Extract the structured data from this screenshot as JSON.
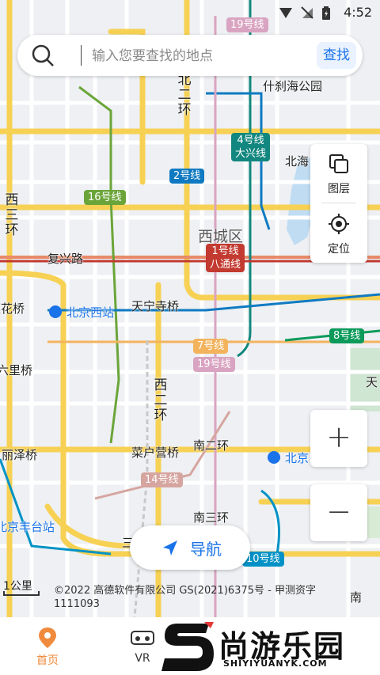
{
  "status_bar": {
    "time": "4:52"
  },
  "search": {
    "placeholder": "输入您要查找的地点",
    "button_label": "查找"
  },
  "side_panel": {
    "layers_label": "图层",
    "locate_label": "定位"
  },
  "zoom": {
    "in_label": "+",
    "out_label": "−"
  },
  "navigate": {
    "label": "导航"
  },
  "map": {
    "scale_label": "1公里",
    "copyright": "©2022 高德软件有限公司 GS(2021)6375号 - 甲测资字1111093",
    "district_label": "西城区",
    "place_labels": {
      "shichahai": "什刹海公园",
      "beihai": "北海",
      "fuxinglu": "复兴路",
      "lianhuaqiao": "莲花桥",
      "beijingxizhan": "北京西站",
      "tianningsiqiao": "天宁寺桥",
      "liuliqiao": "六里桥",
      "lizeqiao": "丽泽桥",
      "caihuyingqiao": "菜户营桥",
      "nanerhuan": "南二环",
      "nansanhuan": "南三环",
      "beijingfengtaizhan": "北京丰台站",
      "beijingnan": "北京",
      "tian": "天",
      "nan": "南",
      "san": "三"
    },
    "ring_labels": {
      "xierhuan_v": "西二环",
      "xisanhuan_v": "西三环",
      "beierhuan_v": "北二环"
    },
    "metro_badges": {
      "line19_top": "19号线",
      "line4": "4号线\n大兴线",
      "line2": "2号线",
      "line16": "16号线",
      "line1": "1号线\n八通线",
      "line7": "7号线",
      "line19": "19号线",
      "line8": "8号线",
      "line14": "14号线",
      "line10": "10号线"
    },
    "colors": {
      "expressway": "#f7d154",
      "ring": "#f3c341",
      "road": "#ffffff",
      "line4": "#12877f",
      "line2": "#0f7ac2",
      "line16": "#6ba53a",
      "line1": "#c23a30",
      "line7": "#f3b35d",
      "line19": "#d9a4c1",
      "line8": "#0b9a5a",
      "line14": "#d6a5a0",
      "line10": "#0092c6"
    }
  },
  "bottom_tabs": [
    {
      "label": "首页",
      "icon": "location-pin-icon",
      "active": true
    },
    {
      "label": "VR",
      "icon": "vr-glasses-icon",
      "active": false
    }
  ],
  "watermark": {
    "cn": "尚游乐园",
    "en": "SHIYIYUANYK.COM"
  }
}
